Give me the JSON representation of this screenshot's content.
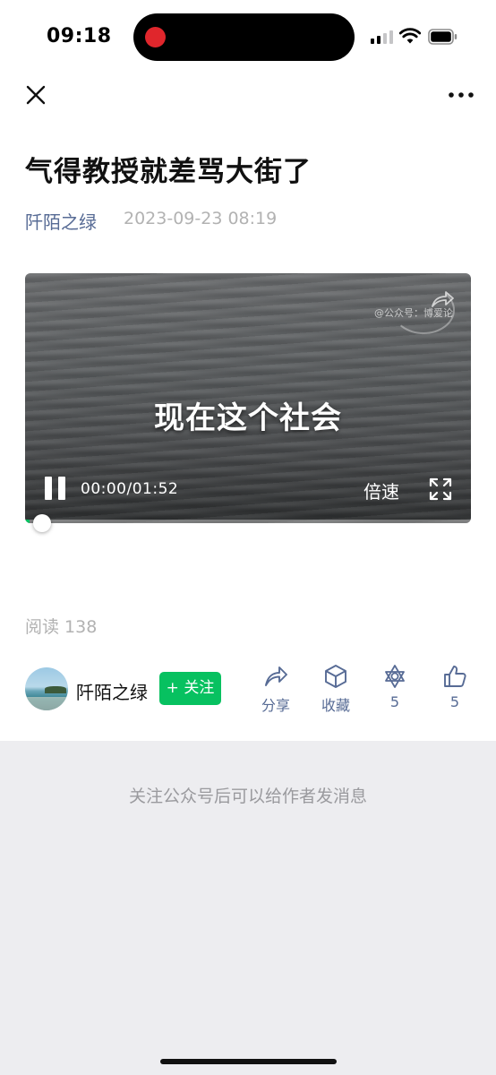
{
  "status_bar": {
    "time": "09:18",
    "recording_indicator_color": "#e0262c",
    "signal_icon": "cellular-signal-icon",
    "wifi_icon": "wifi-icon",
    "battery_icon": "battery-icon"
  },
  "nav": {
    "close_icon": "close-icon",
    "more_icon": "more-icon"
  },
  "article": {
    "title": "气得教授就差骂大街了",
    "author": "阡陌之绿",
    "date": "2023-09-23 08:19",
    "read_count": "阅读 138"
  },
  "video": {
    "watermark": "@公众号：博爱论",
    "caption": "现在这个社会",
    "time": "00:00/01:52",
    "speed_label": "倍速",
    "progress": 0.01,
    "accent_color": "#07c160"
  },
  "author_bar": {
    "name": "阡陌之绿",
    "follow_label": "+ 关注",
    "actions": [
      {
        "icon": "share-icon",
        "label": "分享"
      },
      {
        "icon": "favorite-cube-icon",
        "label": "收藏"
      },
      {
        "icon": "wow-icon",
        "label": "5"
      },
      {
        "icon": "thumbs-up-icon",
        "label": "5"
      }
    ]
  },
  "footer": {
    "notice": "关注公众号后可以给作者发消息"
  },
  "colors": {
    "link": "#576b95",
    "muted": "#b2b2b2",
    "brand_green": "#07c160",
    "page_gray": "#ededf0"
  }
}
